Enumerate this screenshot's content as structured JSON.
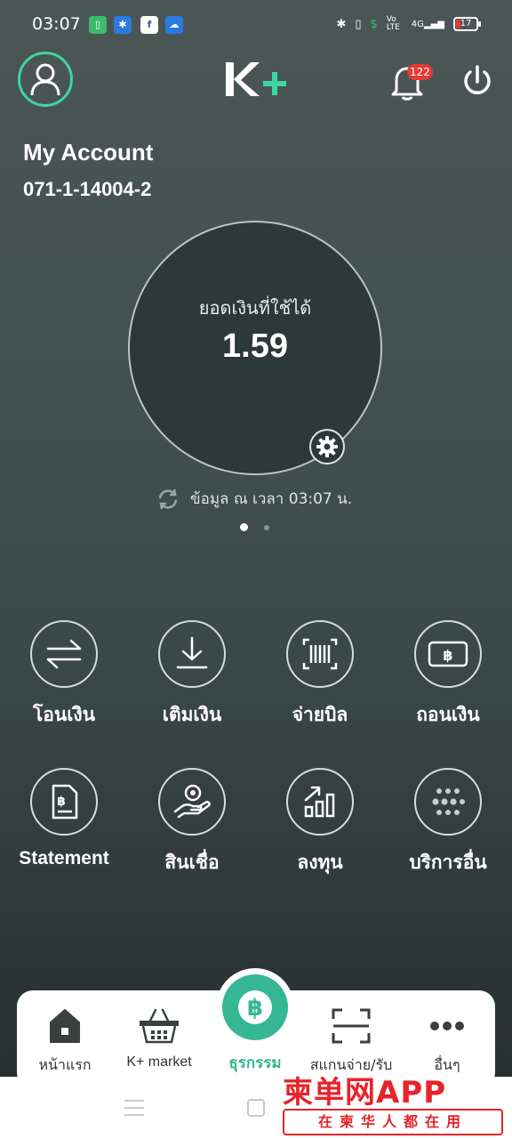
{
  "status_bar": {
    "time": "03:07",
    "battery": "17",
    "network": "4G",
    "volte": "Vo LTE"
  },
  "header": {
    "logo_text": "K+",
    "notification_count": "122"
  },
  "account": {
    "title": "My Account",
    "number": "071-1-14004-2"
  },
  "balance": {
    "label": "ยอดเงินที่ใช้ได้",
    "value": "1.59",
    "updated_text": "ข้อมูล ณ เวลา 03:07 น."
  },
  "services": [
    {
      "label": "โอนเงิน",
      "icon": "transfer-icon"
    },
    {
      "label": "เติมเงิน",
      "icon": "topup-icon"
    },
    {
      "label": "จ่ายบิล",
      "icon": "barcode-icon"
    },
    {
      "label": "ถอนเงิน",
      "icon": "withdraw-icon"
    },
    {
      "label": "Statement",
      "icon": "statement-icon"
    },
    {
      "label": "สินเชื่อ",
      "icon": "loan-icon"
    },
    {
      "label": "ลงทุน",
      "icon": "invest-icon"
    },
    {
      "label": "บริการอื่น",
      "icon": "more-services-icon"
    }
  ],
  "bottom_nav": {
    "home": "หน้าแรก",
    "market": "K+ market",
    "transactions": "ธุรกรรม",
    "scan": "สแกนจ่าย/รับ",
    "more": "อื่นๆ"
  },
  "watermark": {
    "title": "柬单网APP",
    "subtitle": "在柬华人都在用"
  },
  "colors": {
    "accent_green": "#34b792",
    "avatar_ring": "#3dd6a1",
    "badge_red": "#e53935"
  }
}
